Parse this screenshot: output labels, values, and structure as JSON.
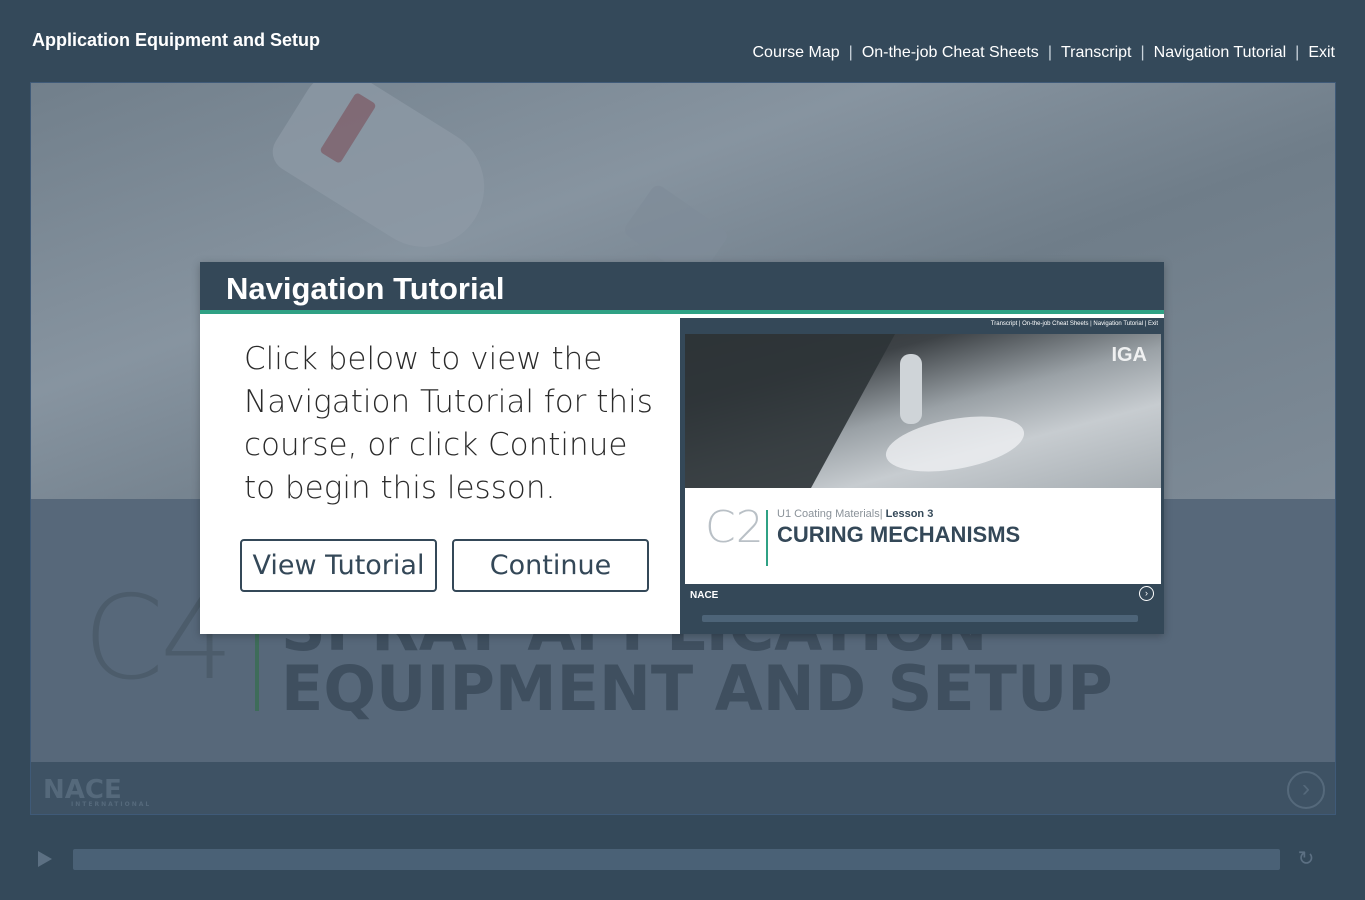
{
  "header": {
    "course_title": "Application Equipment and Setup",
    "nav": [
      "Course Map",
      "On-the-job Cheat Sheets",
      "Transcript",
      "Navigation Tutorial",
      "Exit"
    ],
    "separator": "|"
  },
  "slide": {
    "code": "C4",
    "title_line1": "SPRAY APPLICATION",
    "title_line2": "EQUIPMENT AND SETUP",
    "logo_text": "NACE",
    "logo_sub": "INTERNATIONAL"
  },
  "modal": {
    "title": "Navigation Tutorial",
    "body": "Click below to view the Navigation Tutorial for this course, or click Continue to begin this lesson.",
    "view_button": "View Tutorial",
    "continue_button": "Continue",
    "preview": {
      "nav": "Transcript | On-the-job Cheat Sheets | Navigation Tutorial | Exit",
      "watermark": "IGA",
      "code": "C2",
      "subtitle_prefix": "U1 Coating Materials|",
      "subtitle_lesson": "Lesson 3",
      "title": "CURING MECHANISMS",
      "logo": "NACE"
    }
  },
  "player": {
    "play_icon": "play-icon",
    "replay_icon": "replay-icon"
  },
  "colors": {
    "background": "#34495a",
    "accent_green": "#2fa184",
    "modal_header": "#344858"
  }
}
